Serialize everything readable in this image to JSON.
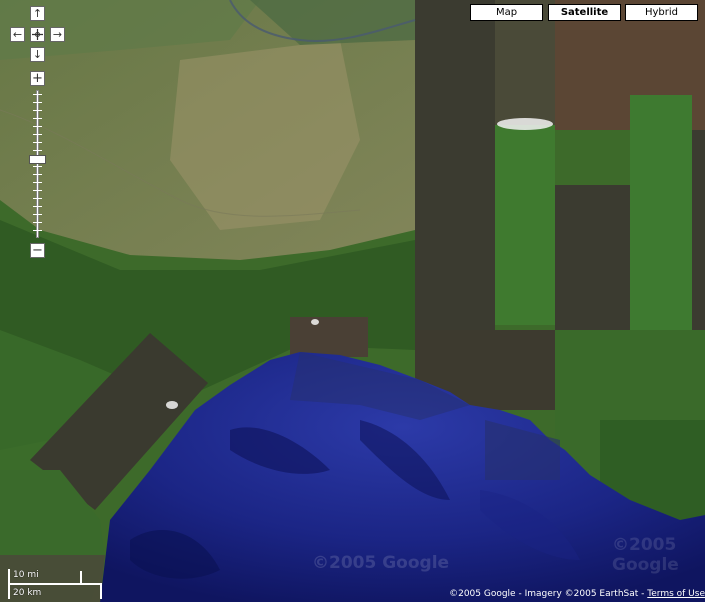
{
  "map": {
    "type_buttons": [
      {
        "label": "Map",
        "active": false
      },
      {
        "label": "Satellite",
        "active": true
      },
      {
        "label": "Hybrid",
        "active": false
      }
    ],
    "nav": {
      "up": "↑",
      "down": "↓",
      "left": "←",
      "right": "→",
      "zoom_in": "+",
      "zoom_out": "−"
    },
    "scale": {
      "miles": "10 mi",
      "km": "20 km"
    },
    "copyright": {
      "text": "©2005 Google - Imagery ©2005 EarthSat -",
      "terms": "Terms of Use"
    },
    "watermark": "©2005 Google",
    "colors": {
      "sea": "#1e2a8c",
      "land_green": "#3f6e2a",
      "land_dark": "#3a3a2e",
      "plain": "#8a8a60"
    }
  }
}
